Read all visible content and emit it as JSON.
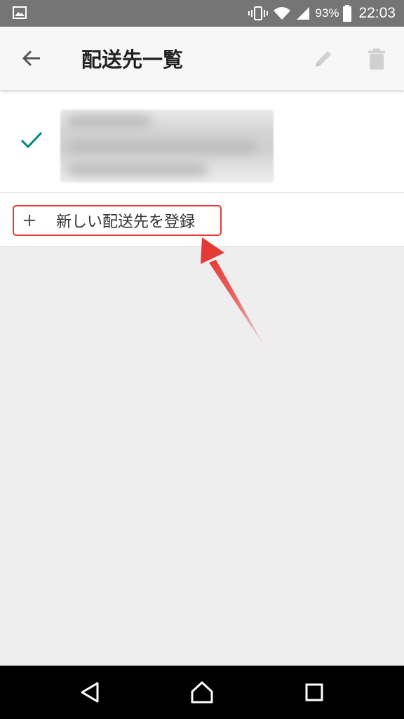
{
  "status_bar": {
    "battery_percent": "93%",
    "time": "22:03",
    "icons": [
      "gallery-icon",
      "vibrate-icon",
      "wifi-icon",
      "signal-icon",
      "battery-icon"
    ]
  },
  "toolbar": {
    "title": "配送先一覧",
    "back_icon": "arrow-back-icon",
    "edit_icon": "pencil-icon",
    "delete_icon": "trash-icon"
  },
  "address_list": {
    "selected_icon": "check-icon",
    "address_redacted": true
  },
  "add_address": {
    "plus": "+",
    "label": "新しい配送先を登録"
  },
  "annotation": {
    "arrow_color": "#e53935",
    "highlight_color": "#e53935"
  },
  "nav_bar": {
    "buttons": [
      "back-triangle-icon",
      "home-icon",
      "recents-icon"
    ]
  },
  "colors": {
    "accent_check": "#00897b",
    "toolbar_bg": "#f7f7f7",
    "status_bar_bg": "#757575",
    "content_bg": "#eeeeee"
  }
}
